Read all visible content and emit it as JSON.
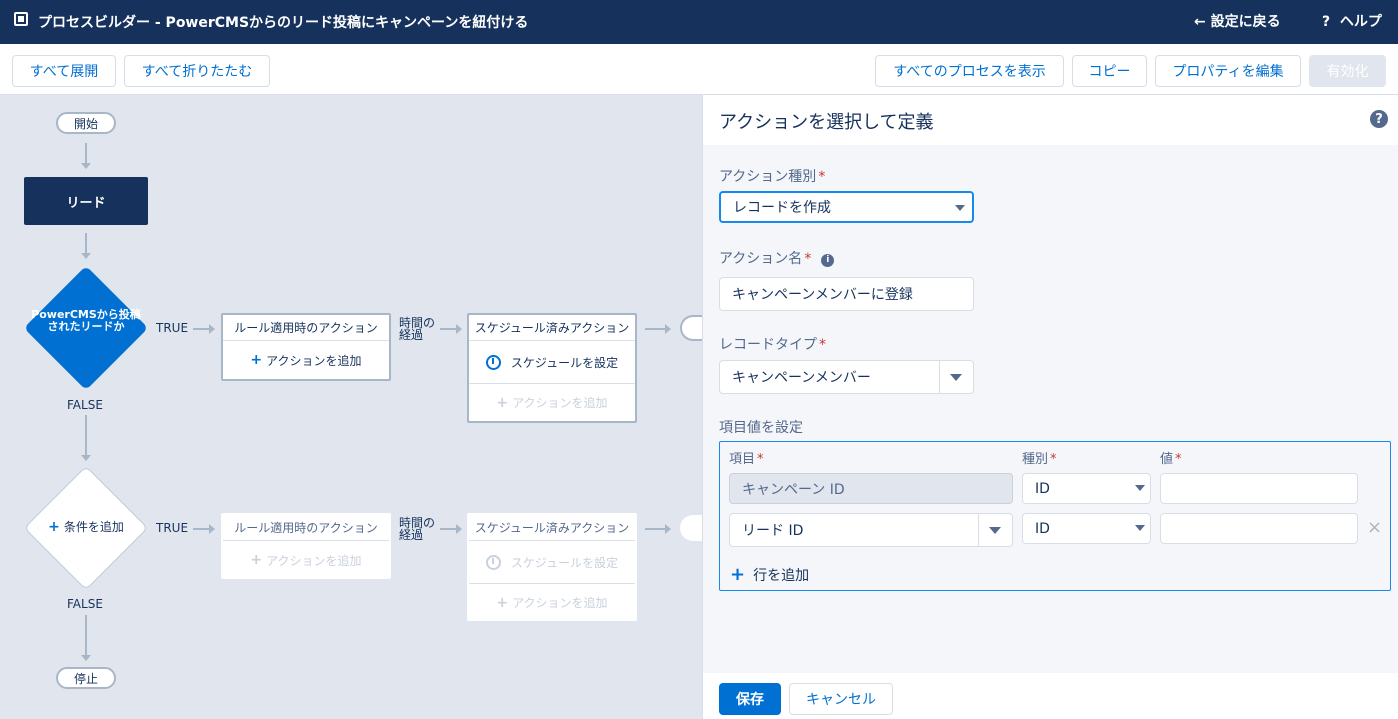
{
  "header": {
    "title": "プロセスビルダー - PowerCMSからのリード投稿にキャンペーンを紐付ける",
    "back_label": "設定に戻る",
    "help_label": "ヘルプ"
  },
  "toolbar": {
    "expand_all": "すべて展開",
    "collapse_all": "すべて折りたたむ",
    "show_all_processes": "すべてのプロセスを表示",
    "copy": "コピー",
    "edit_properties": "プロパティを編集",
    "activate": "有効化"
  },
  "canvas": {
    "start_label": "開始",
    "object_label": "リード",
    "criteria_1": {
      "label": "PowerCMSから投稿されたリードか",
      "true_label": "TRUE",
      "false_label": "FALSE",
      "immediate_title": "ルール適用時のアクション",
      "immediate_add": "アクションを追加",
      "time_label": "時間の経過",
      "scheduled_title": "スケジュール済みアクション",
      "schedule_set": "スケジュールを設定",
      "scheduled_add": "アクションを追加"
    },
    "criteria_2": {
      "label": "条件を追加",
      "true_label": "TRUE",
      "false_label": "FALSE",
      "immediate_title": "ルール適用時のアクション",
      "immediate_add": "アクションを追加",
      "time_label": "時間の経過",
      "scheduled_title": "スケジュール済みアクション",
      "schedule_set": "スケジュールを設定",
      "scheduled_add": "アクションを追加"
    },
    "stop_label": "停止"
  },
  "panel": {
    "title": "アクションを選択して定義",
    "action_type_label": "アクション種別",
    "action_type_value": "レコードを作成",
    "action_name_label": "アクション名",
    "action_name_value": "キャンペーンメンバーに登録",
    "record_type_label": "レコードタイプ",
    "record_type_value": "キャンペーンメンバー",
    "set_fields_label": "項目値を設定",
    "columns": {
      "field": "項目",
      "type": "種別",
      "value": "値"
    },
    "rows": [
      {
        "field": "キャンペーン ID",
        "type": "ID",
        "value": ""
      },
      {
        "field": "リード ID",
        "type": "ID",
        "value": ""
      }
    ],
    "add_row": "行を追加",
    "save": "保存",
    "cancel": "キャンセル"
  },
  "colors": {
    "header_bg": "#16325c",
    "brand_blue": "#0070d2",
    "canvas_bg": "#e0e5ee",
    "required_red": "#c23934"
  }
}
